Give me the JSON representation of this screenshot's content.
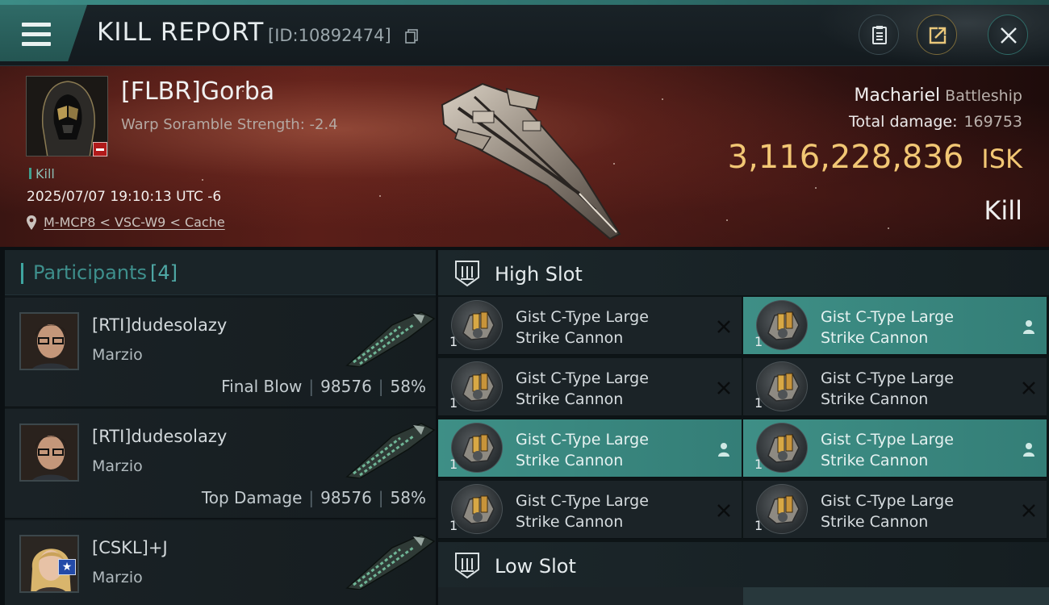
{
  "header": {
    "title": "KILL REPORT",
    "report_id": "[ID:10892474]",
    "icons": {
      "menu": "hamburger-menu-icon",
      "copy": "copy-icon",
      "clipboard": "clipboard-icon",
      "share": "share-icon",
      "close": "close-icon"
    }
  },
  "victim": {
    "name": "[FLBR]Gorba",
    "warp_scramble": "Warp Soramble Strength: -2.4",
    "tag": "Kill",
    "timestamp": "2025/07/07 19:10:13 UTC -6",
    "location": "M-MCP8 < VSC-W9 < Cache",
    "ship_name": "Machariel",
    "ship_class": "Battleship",
    "total_damage_label": "Total damage:",
    "total_damage_value": "169753",
    "isk_value": "3,116,228,836",
    "isk_unit": "ISK",
    "result": "Kill",
    "standing_color": "#b11a1a"
  },
  "participants": {
    "title": "Participants",
    "count": "[4]",
    "rows": [
      {
        "name": "[RTI]dudesolazy",
        "ship": "Marzio",
        "role": "Final Blow",
        "damage": "98576",
        "percent": "58%"
      },
      {
        "name": "[RTI]dudesolazy",
        "ship": "Marzio",
        "role": "Top Damage",
        "damage": "98576",
        "percent": "58%"
      },
      {
        "name": "[CSKL]+J",
        "ship": "Marzio",
        "star": "★"
      }
    ]
  },
  "fitting": {
    "high_slot_title": "High Slot",
    "low_slot_title": "Low Slot",
    "accent_color": "#3e8f86",
    "high_slot_modules": [
      {
        "line1": "Gist C-Type Large",
        "line2": "Strike Cannon",
        "qty": "1",
        "status": "destroyed",
        "icon": "x-icon"
      },
      {
        "line1": "Gist C-Type Large",
        "line2": "Strike Cannon",
        "qty": "1",
        "status": "dropped",
        "icon": "person-icon"
      },
      {
        "line1": "Gist C-Type Large",
        "line2": "Strike Cannon",
        "qty": "1",
        "status": "destroyed",
        "icon": "x-icon"
      },
      {
        "line1": "Gist C-Type Large",
        "line2": "Strike Cannon",
        "qty": "1",
        "status": "destroyed",
        "icon": "x-icon"
      },
      {
        "line1": "Gist C-Type Large",
        "line2": "Strike Cannon",
        "qty": "1",
        "status": "dropped",
        "icon": "person-icon"
      },
      {
        "line1": "Gist C-Type Large",
        "line2": "Strike Cannon",
        "qty": "1",
        "status": "dropped",
        "icon": "person-icon"
      },
      {
        "line1": "Gist C-Type Large",
        "line2": "Strike Cannon",
        "qty": "1",
        "status": "destroyed",
        "icon": "x-icon"
      },
      {
        "line1": "Gist C-Type Large",
        "line2": "Strike Cannon",
        "qty": "1",
        "status": "destroyed",
        "icon": "x-icon"
      }
    ]
  }
}
